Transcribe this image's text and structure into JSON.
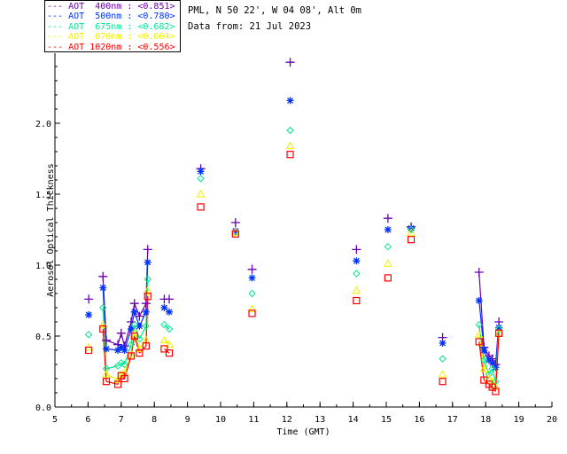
{
  "header": {
    "site": "PML, N 50 22', W 04 08', Alt 0m",
    "date": "Data from: 21 Jul 2023"
  },
  "chart_data": {
    "type": "scatter",
    "xlabel": "Time (GMT)",
    "ylabel": "Aerosol Optical Thickness",
    "xlim": [
      5,
      20
    ],
    "ylim": [
      0,
      2.5
    ],
    "xticks": [
      5,
      6,
      7,
      8,
      9,
      10,
      11,
      12,
      13,
      14,
      15,
      16,
      17,
      18,
      19,
      20
    ],
    "yticks": [
      0.0,
      0.5,
      1.0,
      1.5,
      2.0
    ],
    "ytick_labels": [
      "0.0",
      "0.5",
      "1.0",
      "1.5",
      "2.0"
    ],
    "grid": false,
    "legend_position": "top-left outside",
    "x": [
      6.02,
      6.45,
      6.55,
      6.9,
      7.0,
      7.1,
      7.3,
      7.4,
      7.55,
      7.75,
      7.8,
      8.3,
      8.45,
      9.4,
      10.45,
      10.95,
      12.1,
      14.1,
      15.05,
      15.75,
      16.7,
      17.8,
      17.95,
      18.1,
      18.2,
      18.3,
      18.4
    ],
    "series": [
      {
        "name": "AOT  400nm : <0.851>",
        "color": "#6a00b0",
        "marker": "plus",
        "values": [
          0.76,
          0.92,
          0.47,
          0.44,
          0.52,
          0.43,
          0.6,
          0.73,
          0.64,
          0.73,
          1.11,
          0.76,
          0.76,
          1.68,
          1.3,
          0.97,
          2.43,
          1.11,
          1.33,
          1.27,
          0.49,
          0.95,
          0.42,
          0.36,
          0.34,
          0.3,
          0.6
        ]
      },
      {
        "name": "AOT  500nm : <0.780>",
        "color": "#0030ff",
        "marker": "asterisk",
        "values": [
          0.65,
          0.84,
          0.41,
          0.4,
          0.42,
          0.4,
          0.55,
          0.67,
          0.57,
          0.67,
          1.02,
          0.7,
          0.67,
          1.66,
          1.24,
          0.91,
          2.16,
          1.03,
          1.25,
          1.26,
          0.45,
          0.75,
          0.4,
          0.33,
          0.31,
          0.28,
          0.56
        ]
      },
      {
        "name": "AOT  675nm : <0.682>",
        "color": "#00e890",
        "marker": "diamond",
        "values": [
          0.51,
          0.7,
          0.27,
          0.29,
          0.31,
          0.3,
          0.44,
          0.58,
          0.48,
          0.57,
          0.9,
          0.58,
          0.55,
          1.61,
          1.23,
          0.8,
          1.95,
          0.94,
          1.13,
          1.25,
          0.34,
          0.58,
          0.33,
          0.23,
          0.27,
          0.18,
          0.55
        ]
      },
      {
        "name": "AOT  870nm : <0.604>",
        "color": "#f0f000",
        "marker": "triangle",
        "values": [
          0.42,
          0.58,
          0.23,
          0.19,
          0.23,
          0.24,
          0.37,
          0.52,
          0.41,
          0.47,
          0.82,
          0.47,
          0.44,
          1.5,
          1.23,
          0.69,
          1.84,
          0.82,
          1.01,
          1.23,
          0.23,
          0.51,
          0.27,
          0.2,
          0.18,
          0.14,
          0.52
        ]
      },
      {
        "name": "AOT 1020nm : <0.556>",
        "color": "#ff0000",
        "marker": "square",
        "values": [
          0.4,
          0.55,
          0.18,
          0.16,
          0.22,
          0.2,
          0.36,
          0.5,
          0.38,
          0.43,
          0.78,
          0.41,
          0.38,
          1.41,
          1.22,
          0.66,
          1.78,
          0.75,
          0.91,
          1.18,
          0.18,
          0.46,
          0.19,
          0.16,
          0.14,
          0.11,
          0.52
        ]
      }
    ]
  }
}
